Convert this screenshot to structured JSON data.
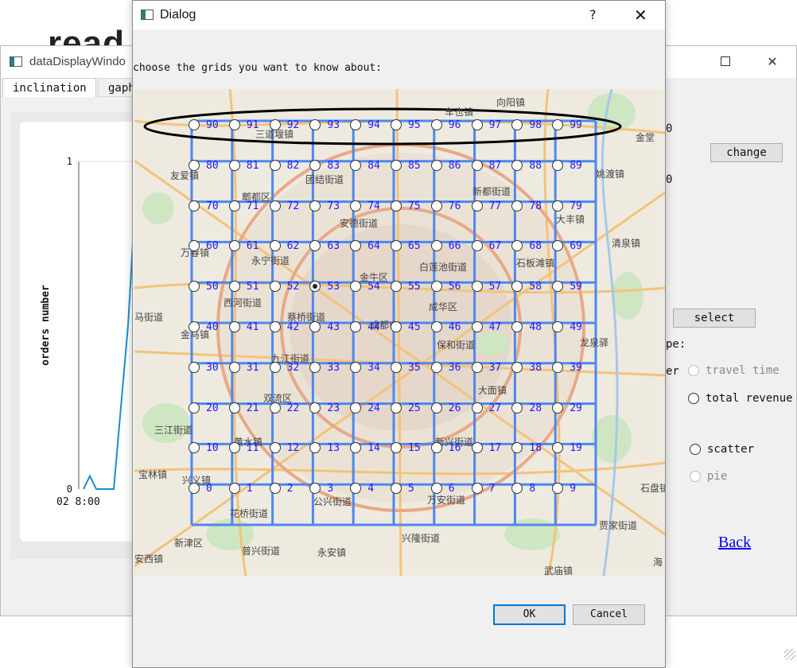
{
  "background": {
    "heading": "read"
  },
  "back_window": {
    "title": "dataDisplayWindo",
    "tabs": [
      "inclination",
      "gaph"
    ],
    "chart": {
      "ylabel": "orders number",
      "y_ticks": [
        "1",
        "0"
      ],
      "x_tick": "02 8:00"
    },
    "change_button": "change",
    "select_button": "select",
    "partial_label_pe": "pe:",
    "partial_label_er": "er",
    "partial_digit_1": "0",
    "partial_digit_2": "0",
    "options": [
      {
        "label": "travel time",
        "enabled": false
      },
      {
        "label": "total revenue",
        "enabled": true
      },
      {
        "label": "scatter",
        "enabled": true
      },
      {
        "label": "pie",
        "enabled": false
      }
    ],
    "back_link": "Back"
  },
  "dialog": {
    "title": "Dialog",
    "help": "?",
    "close": "✕",
    "prompt": "choose the grids you want to know about:",
    "grid": {
      "rows": 10,
      "cols": 10,
      "selected": "53",
      "highlighted_row": [
        "90",
        "91",
        "92",
        "93",
        "94",
        "95",
        "96",
        "97",
        "98",
        "99"
      ]
    },
    "map_places": [
      "向阳镇",
      "车也镇",
      "三道堰镇",
      "金堂",
      "友爱镇",
      "郫都区",
      "团结街道",
      "新都街道",
      "姚渡镇",
      "安德街道",
      "大丰镇",
      "清泉镇",
      "万春镇",
      "永宁街道",
      "白莲池街道",
      "石板滩镇",
      "金牛区",
      "成都市",
      "成华区",
      "西河街道",
      "马街道",
      "金马镇",
      "蔡桥街道",
      "九江街道",
      "保和街道",
      "龙泉驿",
      "双流区",
      "大面镇",
      "三江街道",
      "黄水镇",
      "新兴街道",
      "宝林镇",
      "兴义镇",
      "公兴街道",
      "万安街道",
      "花桥街道",
      "石盘镇",
      "新津区",
      "普兴街道",
      "永安镇",
      "兴隆街道",
      "贾家街道",
      "武庙镇",
      "安西镇",
      "海"
    ],
    "ok_button": "OK",
    "cancel_button": "Cancel"
  }
}
